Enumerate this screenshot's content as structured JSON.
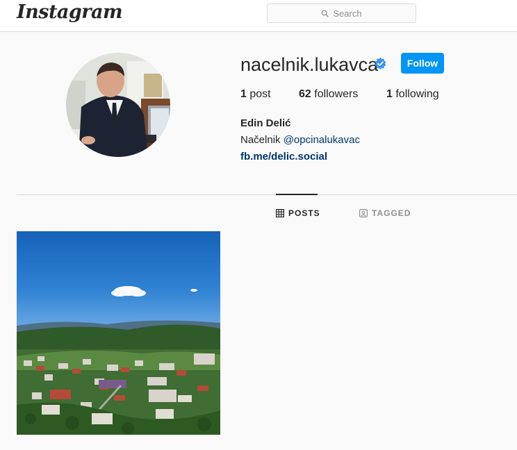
{
  "header": {
    "logo_text": "Instagram",
    "search_placeholder": "Search"
  },
  "profile": {
    "username": "nacelnik.lukavca",
    "verified": true,
    "follow_label": "Follow",
    "stats": {
      "posts_count": "1",
      "posts_label": "post",
      "followers_count": "62",
      "followers_label": "followers",
      "following_count": "1",
      "following_label": "following"
    },
    "full_name": "Edin Delić",
    "bio_prefix": "Načelnik",
    "bio_mention": "@opcinalukavac",
    "website": "fb.me/delic.social"
  },
  "tabs": {
    "posts_label": "POSTS",
    "tagged_label": "TAGGED"
  },
  "colors": {
    "accent": "#0095f6",
    "link": "#00376b",
    "background": "#fafafa",
    "border": "#dbdbdb"
  }
}
